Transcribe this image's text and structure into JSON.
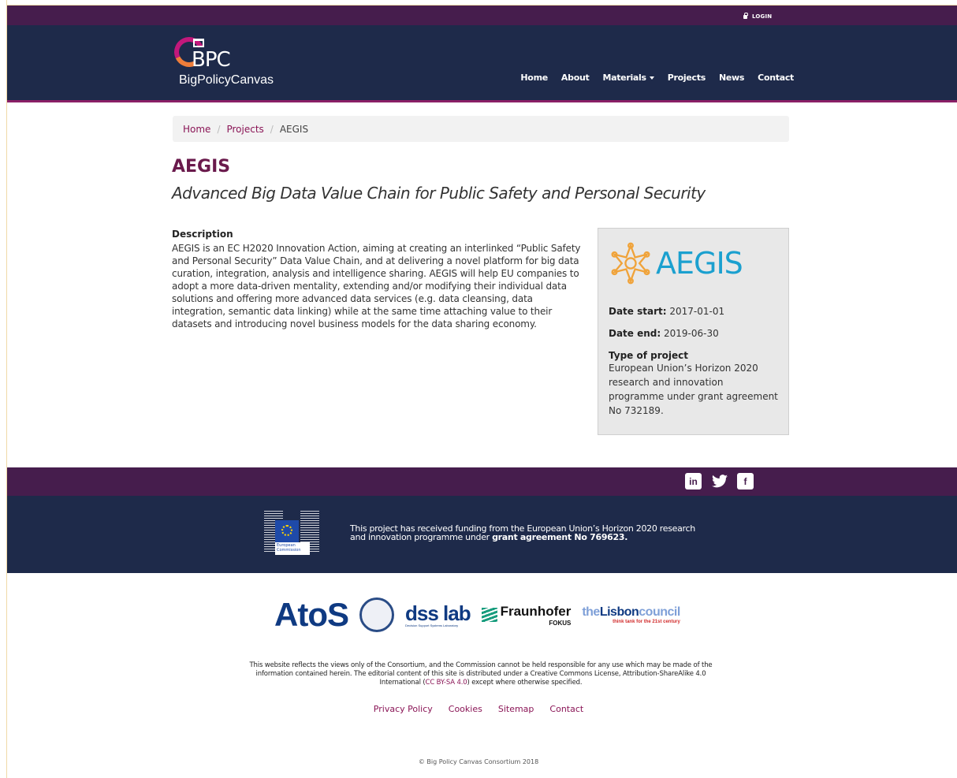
{
  "topbar": {
    "login": "LOGIN"
  },
  "header": {
    "logo_letters": "BPC",
    "logo_text": "BigPolicyCanvas",
    "nav": [
      "Home",
      "About",
      "Materials",
      "Projects",
      "News",
      "Contact"
    ]
  },
  "breadcrumb": {
    "home": "Home",
    "projects": "Projects",
    "current": "AEGIS",
    "sep": "/"
  },
  "project": {
    "title": "AEGIS",
    "subtitle": "Advanced Big Data Value Chain for Public Safety and Personal Security",
    "description_label": "Description",
    "description": "AEGIS is an EC H2020 Innovation Action, aiming at creating an interlinked “Public Safety and Personal Security” Data Value Chain, and at delivering a novel platform for big data curation, integration, analysis and intelligence sharing. AEGIS will help EU companies to adopt a more data-driven mentality, extending and/or modifying their individual data solutions and offering more advanced data services (e.g. data cleansing, data integration, semantic data linking) while at the same time attaching value to their datasets and introducing novel business models for the data sharing economy.",
    "logo_word": "AEGIS",
    "date_start_label": "Date start:",
    "date_start": "2017-01-01",
    "date_end_label": "Date end:",
    "date_end": "2019-06-30",
    "type_label": "Type of project",
    "type_text": "European Union’s Horizon 2020 research and innovation programme under grant agreement No 732189."
  },
  "footer": {
    "social": {
      "linkedin": "in",
      "twitter": "🐦",
      "facebook": "f"
    },
    "ec_label": "European Commission",
    "funding_line1": "This project has received funding from the European Union’s Horizon 2020 research",
    "funding_line2": "and innovation programme under",
    "funding_bold": "grant agreement No 769623.",
    "partners": {
      "atos": "AtoS",
      "dss": "dss lab",
      "dss_sub": "Decision Support Systems Laboratory",
      "fraunhofer": "Fraunhofer",
      "fraunhofer_sub": "FOKUS",
      "lisbon_pre": "the",
      "lisbon_mid": "Lisbon",
      "lisbon_post": "council",
      "lisbon_sub": "think tank for the 21st century"
    },
    "disclaimer_1": "This website reflects the views only of the Consortium, and the Commission cannot be held responsible for any use which may be made of the information contained herein. The editorial content of this site is distributed under a Creative Commons License, Attribution-ShareAlike 4.0 International (",
    "disclaimer_link": "CC BY-SA 4.0",
    "disclaimer_2": ") except where otherwise specified.",
    "links": [
      "Privacy Policy",
      "Cookies",
      "Sitemap",
      "Contact"
    ],
    "copyright": "© Big Policy Canvas Consortium 2018"
  },
  "colors": {
    "topbar": "#461d4d",
    "header": "#1e2a4a",
    "accent": "#8a1556",
    "aegis_blue": "#1ba0cf",
    "aegis_orange": "#f0a33a"
  }
}
